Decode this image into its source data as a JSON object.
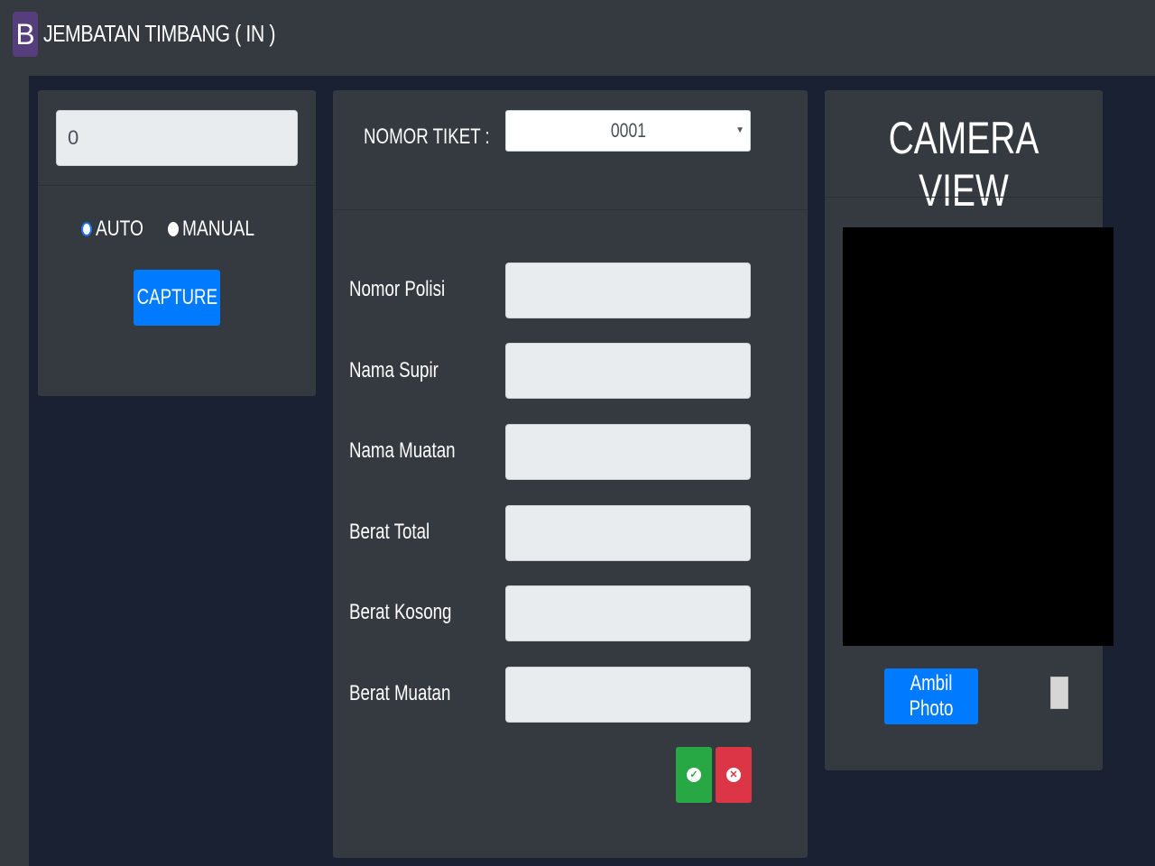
{
  "header": {
    "logo_letter": "B",
    "title": "JEMBATAN TIMBANG ( IN )"
  },
  "scale_panel": {
    "weight_value": "0",
    "mode_options": [
      {
        "label": "AUTO",
        "checked": true
      },
      {
        "label": "MANUAL",
        "checked": false
      }
    ],
    "capture_label": "CAPTURE"
  },
  "ticket_panel": {
    "ticket_label": "NOMOR TIKET :",
    "ticket_selected": "0001",
    "fields": [
      {
        "label": "Nomor Polisi",
        "value": ""
      },
      {
        "label": "Nama Supir",
        "value": ""
      },
      {
        "label": "Nama Muatan",
        "value": ""
      },
      {
        "label": "Berat Total",
        "value": ""
      },
      {
        "label": "Berat Kosong",
        "value": ""
      },
      {
        "label": "Berat Muatan",
        "value": ""
      }
    ]
  },
  "camera_panel": {
    "title": "CAMERA VIEW",
    "take_photo_label": "Ambil Photo"
  },
  "colors": {
    "header_bg": "#343a40",
    "main_bg": "#1a2133",
    "card_bg": "#343a40",
    "primary": "#007bff",
    "success": "#28a745",
    "danger": "#dc3545"
  }
}
